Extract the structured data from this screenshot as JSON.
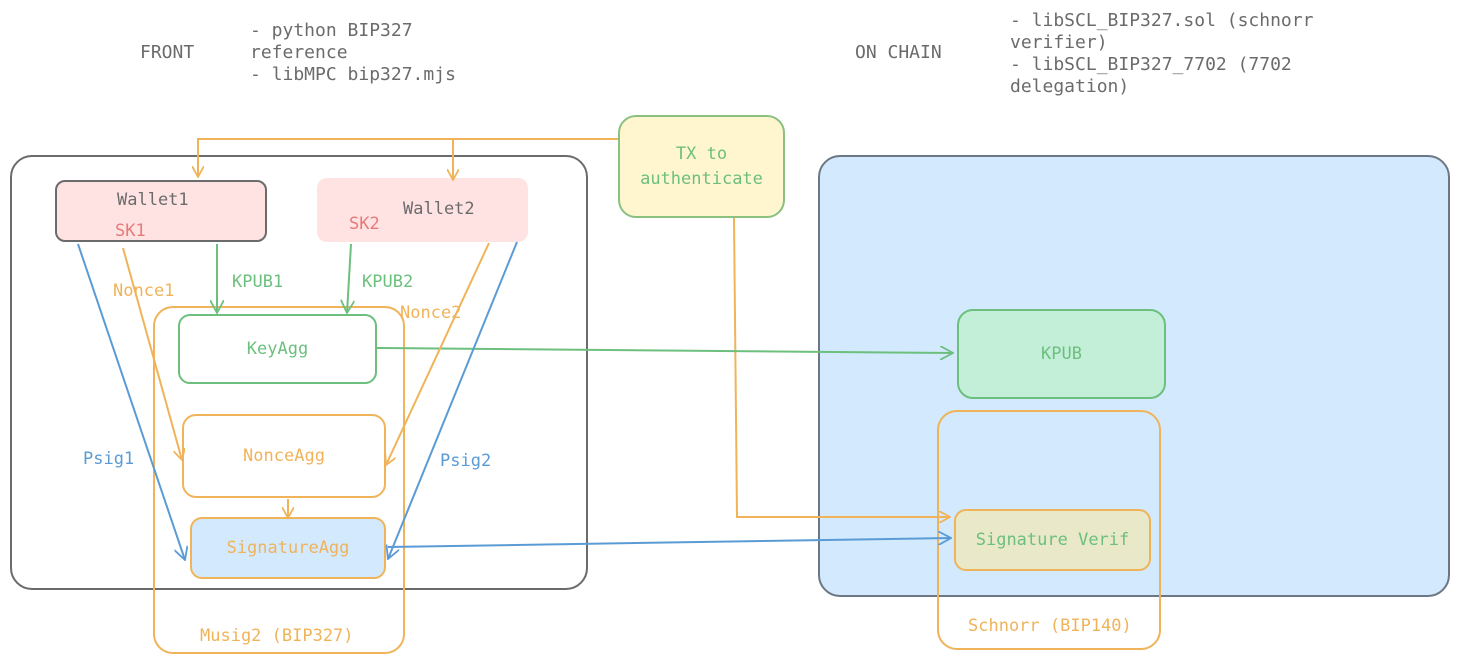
{
  "colors": {
    "gray": "#6b6b6b",
    "orange": "#f0b35a",
    "green": "#6cbf7d",
    "blue": "#5b9bd5",
    "red": "#e77a7a",
    "pink_fill": "#ffe3e3",
    "blue_fill": "#d3e9fd",
    "green_fill": "#c3efd9",
    "yellow_fill": "#fff5cf",
    "verif_fill": "#e9e8c9"
  },
  "sections": {
    "front": {
      "title": "FRONT",
      "notes": [
        "- python BIP327",
        "reference",
        "- libMPC bip327.mjs"
      ]
    },
    "on_chain": {
      "title": "ON CHAIN",
      "notes": [
        "- libSCL_BIP327.sol (schnorr",
        "verifier)",
        "- libSCL_BIP327_7702 (7702",
        "delegation)"
      ]
    }
  },
  "nodes": {
    "tx": "TX to\nauthenticate",
    "wallet1": {
      "title": "Wallet1",
      "key": "SK1"
    },
    "wallet2": {
      "title": "Wallet2",
      "key": "SK2"
    },
    "keyagg": "KeyAgg",
    "nonceagg": "NonceAgg",
    "signatureagg": "SignatureAgg",
    "musig2_group": "Musig2 (BIP327)",
    "kpub": "KPUB",
    "signature_verif": "Signature Verif",
    "schnorr_group": "Schnorr (BIP140)"
  },
  "edge_labels": {
    "kpub1": "KPUB1",
    "kpub2": "KPUB2",
    "nonce1": "Nonce1",
    "nonce2": "Nonce2",
    "psig1": "Psig1",
    "psig2": "Psig2"
  }
}
